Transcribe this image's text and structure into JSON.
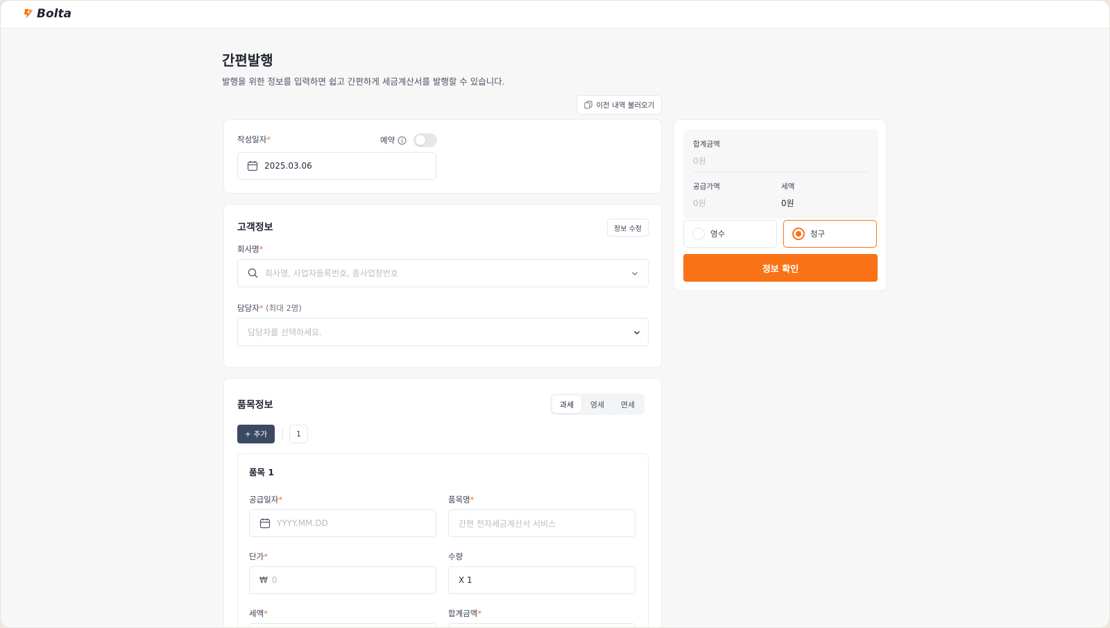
{
  "app": {
    "logo_text": "Bolta",
    "brand_color": "#f97316"
  },
  "page": {
    "title": "간편발행",
    "subtitle": "발행을 위한 정보를 입력하면 쉽고 간편하게 세금계산서를 발행할 수 있습니다."
  },
  "toolbar": {
    "load_previous_label": "이전 내역 불러오기"
  },
  "date_section": {
    "write_date_label": "작성일자",
    "required_mark": "*",
    "reserve_label": "예약",
    "reserve_enabled": false,
    "write_date_value": "2025.03.06"
  },
  "customer": {
    "title": "고객정보",
    "edit_label": "정보 수정",
    "company_label": "회사명",
    "company_placeholder": "회사명, 사업자등록번호, 종사업장번호",
    "manager_label": "담당자",
    "manager_hint": "(최대 2명)",
    "manager_placeholder": "담당자를 선택하세요."
  },
  "items": {
    "title": "품목정보",
    "tax_types": [
      {
        "label": "과세",
        "active": true
      },
      {
        "label": "영세",
        "active": false
      },
      {
        "label": "면세",
        "active": false
      }
    ],
    "add_label": "추가",
    "count": "1",
    "item_title": "품목 1",
    "supply_date_label": "공급일자",
    "supply_date_placeholder": "YYYY.MM.DD",
    "item_name_label": "품목명",
    "item_name_placeholder": "간편 전자세금계산서 서비스",
    "unit_price_label": "단가",
    "currency_symbol": "₩",
    "unit_price_placeholder": "0",
    "quantity_label": "수량",
    "quantity_value": "X 1",
    "tax_label": "세액",
    "total_label": "합계금액"
  },
  "summary": {
    "total_label": "합계금액",
    "total_value": "0원",
    "supply_label": "공급가액",
    "supply_value": "0원",
    "tax_label": "세액",
    "tax_value": "0원",
    "receipt_label": "영수",
    "claim_label": "청구",
    "selected": "claim",
    "confirm_label": "정보 확인"
  }
}
